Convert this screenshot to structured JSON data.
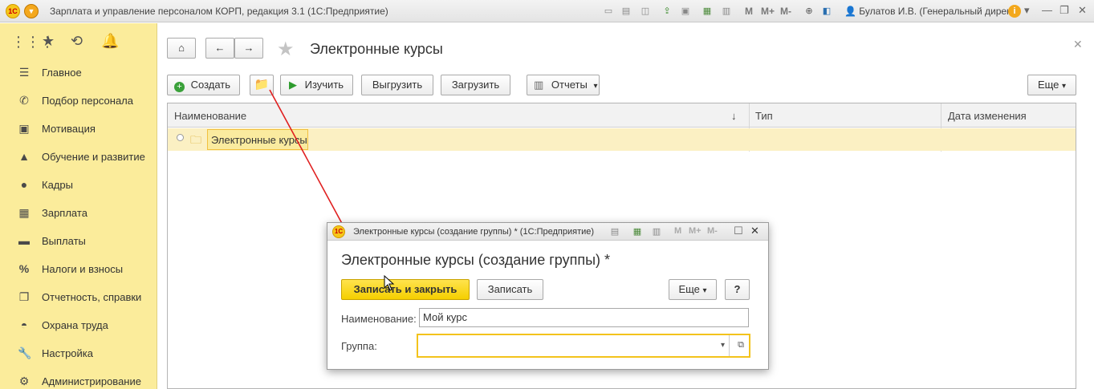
{
  "titlebar": {
    "logo": "1С",
    "title": "Зарплата и управление персоналом КОРП, редакция 3.1  (1С:Предприятие)",
    "m_labels": [
      "M",
      "M+",
      "M-"
    ],
    "user": "Булатов И.В. (Генеральный дирек...",
    "icons": [
      "save-icon",
      "print-icon",
      "preview-icon",
      "upload-icon",
      "print-icon",
      "calculator-icon",
      "calendar-icon",
      "zoom-icon",
      "panel-icon",
      "info-icon",
      "minimize-icon",
      "restore-icon",
      "close-icon"
    ]
  },
  "sidebar": {
    "top_icons": [
      "apps-grid-icon",
      "star-icon",
      "history-icon",
      "bell-icon"
    ],
    "items": [
      {
        "label": "Главное",
        "icon": "menu-icon"
      },
      {
        "label": "Подбор персонала",
        "icon": "phone-icon"
      },
      {
        "label": "Мотивация",
        "icon": "gift-icon"
      },
      {
        "label": "Обучение и развитие",
        "icon": "graduation-cap-icon"
      },
      {
        "label": "Кадры",
        "icon": "people-icon"
      },
      {
        "label": "Зарплата",
        "icon": "calculator-icon"
      },
      {
        "label": "Выплаты",
        "icon": "card-icon"
      },
      {
        "label": "Налоги и взносы",
        "icon": "percent-icon"
      },
      {
        "label": "Отчетность, справки",
        "icon": "documents-icon"
      },
      {
        "label": "Охрана труда",
        "icon": "helmet-icon"
      },
      {
        "label": "Настройка",
        "icon": "wrench-icon"
      },
      {
        "label": "Администрирование",
        "icon": "gear-icon"
      }
    ]
  },
  "main": {
    "title": "Электронные курсы",
    "toolbar": {
      "create": "Создать",
      "study": "Изучить",
      "export": "Выгрузить",
      "import": "Загрузить",
      "reports": "Отчеты",
      "more": "Еще"
    },
    "table": {
      "columns": [
        "Наименование",
        "Тип",
        "Дата изменения"
      ],
      "sort_indicator": "↓",
      "rows": [
        {
          "name": "Электронные курсы",
          "type": "",
          "date": ""
        }
      ]
    }
  },
  "dialog": {
    "window_title": "Электронные курсы (создание группы) *  (1С:Предприятие)",
    "m_labels": [
      "M",
      "M+",
      "M-"
    ],
    "heading": "Электронные курсы (создание группы) *",
    "save_close": "Записать и закрыть",
    "save": "Записать",
    "more": "Еще",
    "help": "?",
    "name_label": "Наименование:",
    "name_value": "Мой курс",
    "group_label": "Группа:",
    "group_value": ""
  },
  "colors": {
    "sidebar_bg": "#fbec9b",
    "primary_button": "#f5cf00",
    "selection_row": "#fbf0c3",
    "annotation_arrow": "#e02020"
  }
}
